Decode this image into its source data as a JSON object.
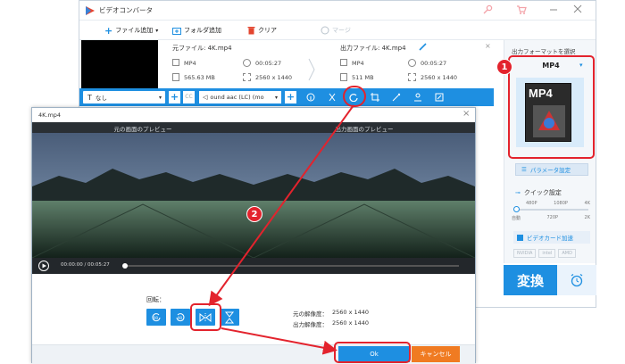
{
  "window": {
    "title": "ビデオコンバータ",
    "toolbar": {
      "add_file": "ファイル追加",
      "add_folder": "フォルダ追加",
      "clear": "クリア",
      "merge": "マージ"
    }
  },
  "file": {
    "source_label": "元ファイル: 4K.mp4",
    "output_label": "出力ファイル: 4K.mp4",
    "src": {
      "format": "MP4",
      "duration": "00:05:27",
      "size": "565.63 MB",
      "resolution": "2560 x 1440"
    },
    "out": {
      "format": "MP4",
      "duration": "00:05:27",
      "size": "511 MB",
      "resolution": "2560 x 1440"
    }
  },
  "editbar": {
    "subtitle": "なし",
    "audio": "ound aac (LC) (mo"
  },
  "right_panel": {
    "header": "出力フォーマットを選択",
    "format": "MP4",
    "format_icon_text": "MP4",
    "param_button": "パラメータ設定",
    "quick_setting": "クイック設定",
    "slider_top": [
      "480P",
      "1080P",
      "4K"
    ],
    "slider_bottom": [
      "自動",
      "720P",
      "2K"
    ],
    "gpu": "ビデオカード加速",
    "gpu_brands": [
      "NVIDIA",
      "intel",
      "AMD"
    ],
    "convert": "変換"
  },
  "dialog": {
    "title": "4K.mp4",
    "left_preview": "元の画面のプレビュー",
    "right_preview": "出力画面のプレビュー",
    "time": "00:00:00 / 00:05:27",
    "rotate_label": "回転：",
    "orig_res_label": "元の解像度：",
    "orig_res": "2560 x 1440",
    "out_res_label": "出力解像度：",
    "out_res": "2560 x 1440",
    "ok": "Ok",
    "cancel": "キャンセル"
  },
  "annotations": {
    "badge1": "1",
    "badge2": "2"
  },
  "colors": {
    "accent": "#1e8fe1",
    "annotation": "#e3232d",
    "cancel": "#f07b22"
  }
}
